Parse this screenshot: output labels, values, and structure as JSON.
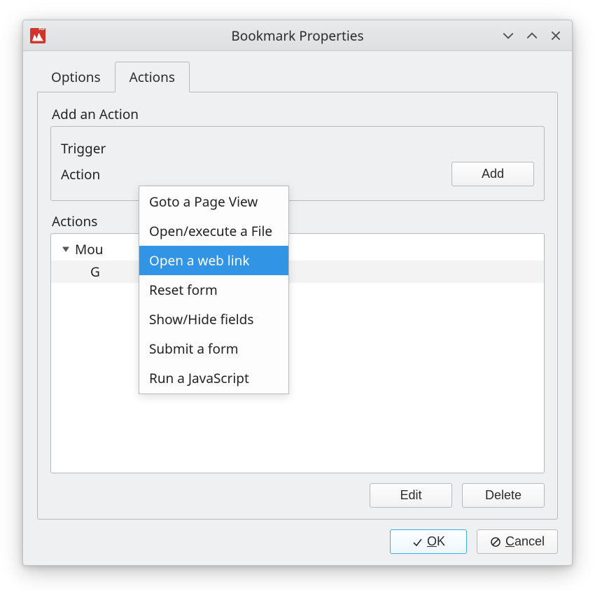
{
  "window": {
    "title": "Bookmark Properties"
  },
  "tabs": {
    "options": "Options",
    "actions": "Actions"
  },
  "addAction": {
    "groupTitle": "Add an Action",
    "triggerLabel": "Trigger",
    "actionLabel": "Action",
    "addButton": "Add"
  },
  "dropdown": {
    "items": [
      "Goto a Page View",
      "Open/execute a File",
      "Open a web link",
      "Reset form",
      "Show/Hide fields",
      "Submit a form",
      "Run a JavaScript"
    ],
    "selectedIndex": 2
  },
  "actionsList": {
    "title": "Actions",
    "root": "Mou",
    "childVisible": "G",
    "editButton": "Edit",
    "deleteButton": "Delete"
  },
  "dialog": {
    "ok": "OK",
    "cancel": "Cancel"
  }
}
